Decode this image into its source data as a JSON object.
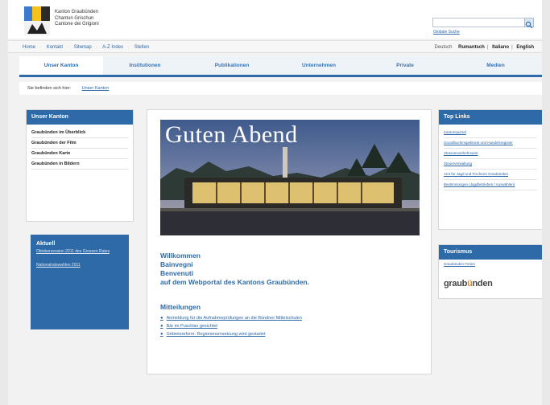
{
  "header": {
    "canton_names": [
      "Kanton Graubünden",
      "Chantun Grischun",
      "Cantone dei Grigioni"
    ],
    "global_search_label": "Globale Suche",
    "search": {
      "placeholder": ""
    }
  },
  "meta_nav": {
    "items": [
      "Home",
      "Kontakt",
      "Sitemap",
      "A-Z Index",
      "Stellen"
    ],
    "current_language": "Deutsch",
    "languages": [
      "Rumantsch",
      "Italiano",
      "English"
    ]
  },
  "main_nav": {
    "tabs": [
      {
        "label": "Unser Kanton",
        "active": true
      },
      {
        "label": "Institutionen",
        "active": false
      },
      {
        "label": "Publikationen",
        "active": false
      },
      {
        "label": "Unternehmen",
        "active": false
      },
      {
        "label": "Private",
        "active": false
      },
      {
        "label": "Medien",
        "active": false
      }
    ]
  },
  "breadcrumb": {
    "label": "Sie befinden sich hier:",
    "link": "Unser Kanton"
  },
  "left_box": {
    "title": "Unser Kanton",
    "items": [
      "Graubünden im Überblick",
      "Graubünden der Film",
      "Graubünden Karte",
      "Graubünden in Bildern"
    ]
  },
  "aktuell": {
    "title": "Aktuell",
    "items": [
      "Oktobersession 2011 des Grossen Rates",
      "Nationalratswahlen 2011"
    ]
  },
  "content": {
    "hero_title": "Guten Abend",
    "welcome": [
      "Willkommen",
      "Bainvegni",
      "Benvenuti",
      "auf dem Webportal des Kantons Graubünden."
    ],
    "news_title": "Mitteilungen",
    "news": [
      "Anmeldung für die Aufnahmeprüfungen an die Bündner Mittelschulen",
      "Bär im Puschlav gesichtet",
      "Gebietsreform: Regionenumsetzung wird gestartet"
    ]
  },
  "top_links": {
    "title": "Top Links",
    "items": [
      "Kantonsportal",
      "Grundbuchinspektorat und Handelsregister",
      "Strassenverkehrsamt",
      "Steuerverwaltung",
      "Amt für Jagd und Fischerei Graubünden",
      "Bestimmungen (Jagdbetrieben / Auswählen)"
    ]
  },
  "tourismus": {
    "title": "Tourismus",
    "link": "Graubünden Ferien",
    "logo_text_a": "graub",
    "logo_text_b": "ü",
    "logo_text_c": "nden"
  },
  "colors": {
    "brand_blue": "#2f6aa8",
    "link_blue": "#2b67a8",
    "logo_orange": "#e08a1e"
  }
}
